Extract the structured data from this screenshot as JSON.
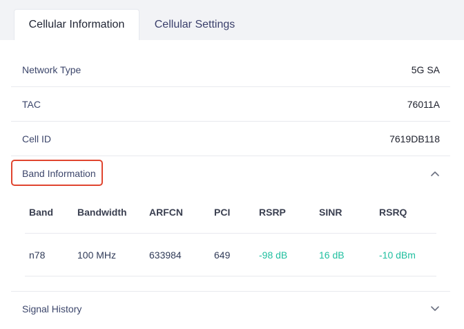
{
  "tabs": {
    "active_label": "Cellular Information",
    "inactive_label": "Cellular Settings"
  },
  "info_rows": [
    {
      "label": "Network Type",
      "value": "5G SA"
    },
    {
      "label": "TAC",
      "value": "76011A"
    },
    {
      "label": "Cell ID",
      "value": "7619DB118"
    }
  ],
  "band_section": {
    "label": "Band Information",
    "expanded": true,
    "columns": {
      "band": "Band",
      "bandwidth": "Bandwidth",
      "arfcn": "ARFCN",
      "pci": "PCI",
      "rsrp": "RSRP",
      "sinr": "SINR",
      "rsrq": "RSRQ"
    },
    "row": {
      "band": "n78",
      "bandwidth": "100 MHz",
      "arfcn": "633984",
      "pci": "649",
      "rsrp": "-98 dB",
      "sinr": "16 dB",
      "rsrq": "-10 dBm"
    }
  },
  "signal_history": {
    "label": "Signal History",
    "expanded": false
  },
  "colors": {
    "signal_value": "#1fbf9f",
    "highlight": "#e0442e"
  }
}
